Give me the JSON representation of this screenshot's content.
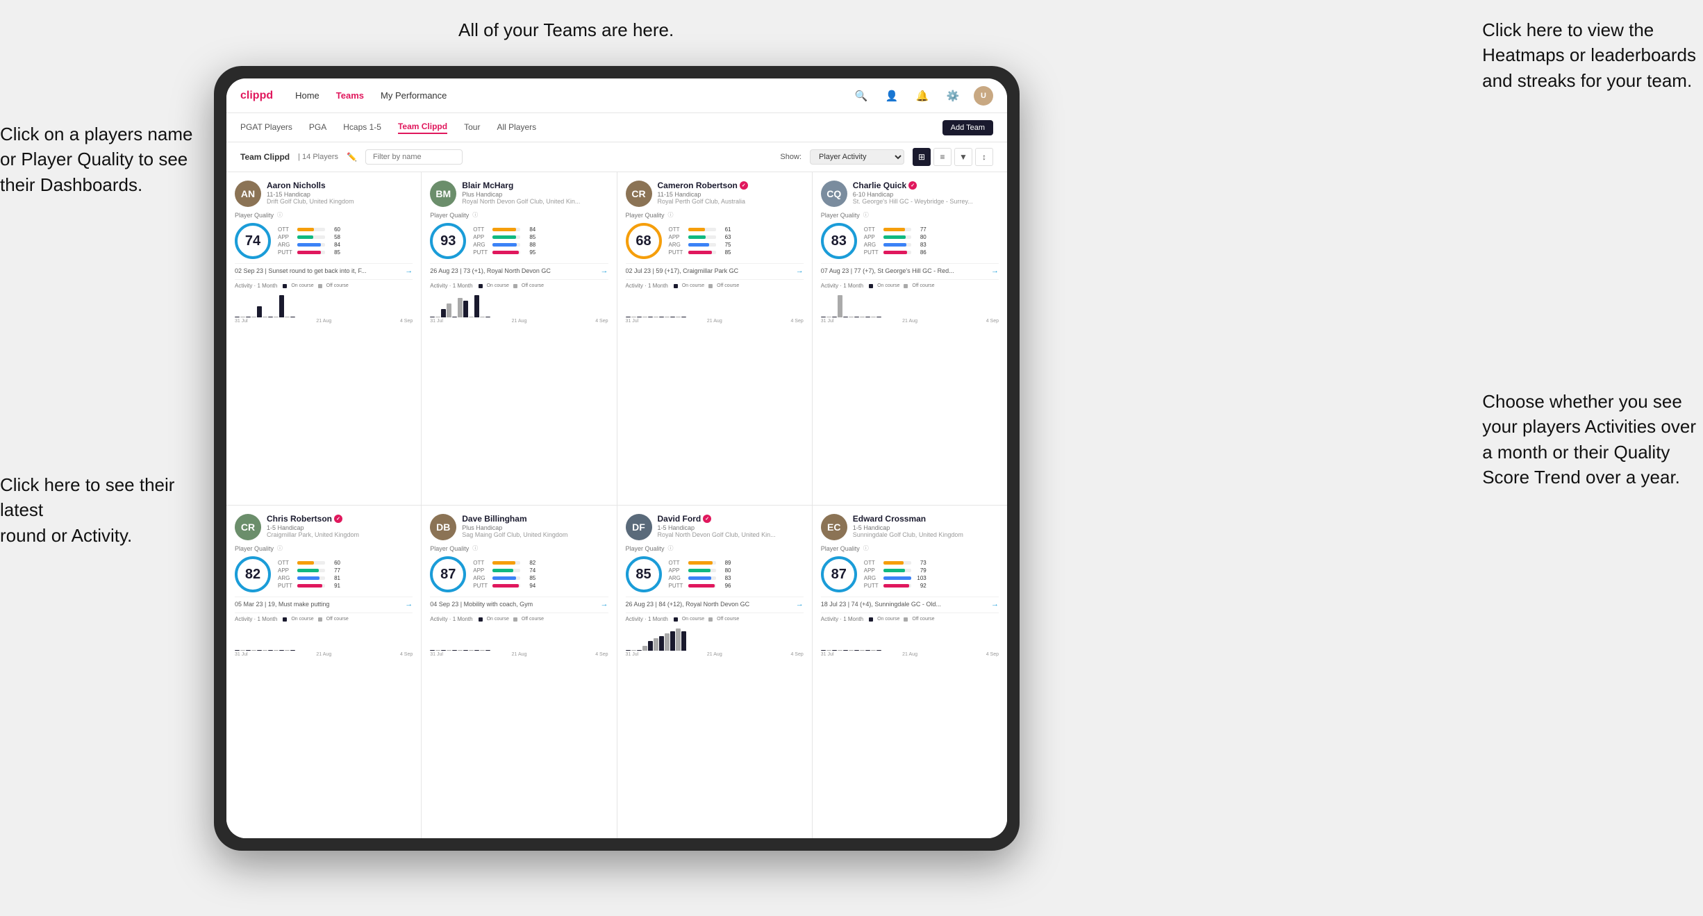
{
  "annotations": {
    "top_left": "Click on a players name\nor Player Quality to see\ntheir Dashboards.",
    "top_center": "All of your Teams are here.",
    "top_right": "Click here to view the\nHeatmaps or leaderboards\nand streaks for your team.",
    "bottom_left": "Click here to see their latest\nround or Activity.",
    "bottom_right": "Choose whether you see\nyour players Activities over\na month or their Quality\nScore Trend over a year."
  },
  "nav": {
    "logo": "clippd",
    "items": [
      "Home",
      "Teams",
      "My Performance"
    ],
    "active": "Teams"
  },
  "sub_nav": {
    "items": [
      "PGAT Players",
      "PGA",
      "Hcaps 1-5",
      "Team Clippd",
      "Tour",
      "All Players"
    ],
    "active": "Team Clippd",
    "add_button": "Add Team"
  },
  "toolbar": {
    "team_label": "Team Clippd",
    "separator": "|",
    "player_count": "14 Players",
    "filter_placeholder": "Filter by name",
    "show_label": "Show:",
    "show_option": "Player Activity",
    "view_label": "Grid view"
  },
  "players": [
    {
      "id": "aaron-nicholls",
      "name": "Aaron Nicholls",
      "handicap": "11-15 Handicap",
      "club": "Drift Golf Club, United Kingdom",
      "verified": false,
      "score": 74,
      "score_color": "#1a9cd8",
      "stats": {
        "OTT": {
          "value": 60,
          "pct": 60
        },
        "APP": {
          "value": 58,
          "pct": 58
        },
        "ARG": {
          "value": 84,
          "pct": 84
        },
        "PUTT": {
          "value": 85,
          "pct": 85
        }
      },
      "latest": "02 Sep 23 | Sunset round to get back into it, F...",
      "chart_bars": [
        0,
        0,
        0,
        0,
        2,
        0,
        0,
        0,
        4,
        0,
        0
      ],
      "chart_labels": [
        "31 Jul",
        "21 Aug",
        "4 Sep"
      ],
      "initials": "AN",
      "avatar_bg": "#8b7355"
    },
    {
      "id": "blair-mcharg",
      "name": "Blair McHarg",
      "handicap": "Plus Handicap",
      "club": "Royal North Devon Golf Club, United Kin...",
      "verified": false,
      "score": 93,
      "score_color": "#1a9cd8",
      "stats": {
        "OTT": {
          "value": 84,
          "pct": 84
        },
        "APP": {
          "value": 85,
          "pct": 85
        },
        "ARG": {
          "value": 88,
          "pct": 88
        },
        "PUTT": {
          "value": 95,
          "pct": 95
        }
      },
      "latest": "26 Aug 23 | 73 (+1), Royal North Devon GC",
      "chart_bars": [
        0,
        0,
        3,
        5,
        0,
        7,
        6,
        0,
        8,
        0,
        0
      ],
      "chart_labels": [
        "31 Jul",
        "21 Aug",
        "4 Sep"
      ],
      "initials": "BM",
      "avatar_bg": "#6b8e6b"
    },
    {
      "id": "cameron-robertson",
      "name": "Cameron Robertson",
      "handicap": "11-15 Handicap",
      "club": "Royal Perth Golf Club, Australia",
      "verified": true,
      "score": 68,
      "score_color": "#f59e0b",
      "stats": {
        "OTT": {
          "value": 61,
          "pct": 61
        },
        "APP": {
          "value": 63,
          "pct": 63
        },
        "ARG": {
          "value": 75,
          "pct": 75
        },
        "PUTT": {
          "value": 85,
          "pct": 85
        }
      },
      "latest": "02 Jul 23 | 59 (+17), Craigmillar Park GC",
      "chart_bars": [
        0,
        0,
        0,
        0,
        0,
        0,
        0,
        0,
        0,
        0,
        0
      ],
      "chart_labels": [
        "31 Jul",
        "21 Aug",
        "4 Sep"
      ],
      "initials": "CR",
      "avatar_bg": "#8b7355"
    },
    {
      "id": "charlie-quick",
      "name": "Charlie Quick",
      "handicap": "6-10 Handicap",
      "club": "St. George's Hill GC - Weybridge - Surrey...",
      "verified": true,
      "score": 83,
      "score_color": "#1a9cd8",
      "stats": {
        "OTT": {
          "value": 77,
          "pct": 77
        },
        "APP": {
          "value": 80,
          "pct": 80
        },
        "ARG": {
          "value": 83,
          "pct": 83
        },
        "PUTT": {
          "value": 86,
          "pct": 86
        }
      },
      "latest": "07 Aug 23 | 77 (+7), St George's Hill GC - Red...",
      "chart_bars": [
        0,
        0,
        0,
        4,
        0,
        0,
        0,
        0,
        0,
        0,
        0
      ],
      "chart_labels": [
        "31 Jul",
        "21 Aug",
        "4 Sep"
      ],
      "initials": "CQ",
      "avatar_bg": "#7a8c9e"
    },
    {
      "id": "chris-robertson",
      "name": "Chris Robertson",
      "handicap": "1-5 Handicap",
      "club": "Craigmillar Park, United Kingdom",
      "verified": true,
      "score": 82,
      "score_color": "#1a9cd8",
      "stats": {
        "OTT": {
          "value": 60,
          "pct": 60
        },
        "APP": {
          "value": 77,
          "pct": 77
        },
        "ARG": {
          "value": 81,
          "pct": 81
        },
        "PUTT": {
          "value": 91,
          "pct": 91
        }
      },
      "latest": "05 Mar 23 | 19, Must make putting",
      "chart_bars": [
        0,
        0,
        0,
        0,
        0,
        0,
        0,
        0,
        0,
        0,
        0
      ],
      "chart_labels": [
        "31 Jul",
        "21 Aug",
        "4 Sep"
      ],
      "initials": "CR",
      "avatar_bg": "#6b8e6b"
    },
    {
      "id": "dave-billingham",
      "name": "Dave Billingham",
      "handicap": "Plus Handicap",
      "club": "Sag Maing Golf Club, United Kingdom",
      "verified": false,
      "score": 87,
      "score_color": "#1a9cd8",
      "stats": {
        "OTT": {
          "value": 82,
          "pct": 82
        },
        "APP": {
          "value": 74,
          "pct": 74
        },
        "ARG": {
          "value": 85,
          "pct": 85
        },
        "PUTT": {
          "value": 94,
          "pct": 94
        }
      },
      "latest": "04 Sep 23 | Mobility with coach, Gym",
      "chart_bars": [
        0,
        0,
        0,
        0,
        0,
        0,
        0,
        0,
        0,
        0,
        0
      ],
      "chart_labels": [
        "31 Jul",
        "21 Aug",
        "4 Sep"
      ],
      "initials": "DB",
      "avatar_bg": "#8b7355"
    },
    {
      "id": "david-ford",
      "name": "David Ford",
      "handicap": "1-5 Handicap",
      "club": "Royal North Devon Golf Club, United Kin...",
      "verified": true,
      "score": 85,
      "score_color": "#1a9cd8",
      "stats": {
        "OTT": {
          "value": 89,
          "pct": 89
        },
        "APP": {
          "value": 80,
          "pct": 80
        },
        "ARG": {
          "value": 83,
          "pct": 83
        },
        "PUTT": {
          "value": 96,
          "pct": 96
        }
      },
      "latest": "26 Aug 23 | 84 (+12), Royal North Devon GC",
      "chart_bars": [
        0,
        0,
        0,
        2,
        4,
        5,
        6,
        7,
        8,
        9,
        8
      ],
      "chart_labels": [
        "31 Jul",
        "21 Aug",
        "4 Sep"
      ],
      "initials": "DF",
      "avatar_bg": "#5a6a7a"
    },
    {
      "id": "edward-crossman",
      "name": "Edward Crossman",
      "handicap": "1-5 Handicap",
      "club": "Sunningdale Golf Club, United Kingdom",
      "verified": false,
      "score": 87,
      "score_color": "#1a9cd8",
      "stats": {
        "OTT": {
          "value": 73,
          "pct": 73
        },
        "APP": {
          "value": 79,
          "pct": 79
        },
        "ARG": {
          "value": 103,
          "pct": 100
        },
        "PUTT": {
          "value": 92,
          "pct": 92
        }
      },
      "latest": "18 Jul 23 | 74 (+4), Sunningdale GC - Old...",
      "chart_bars": [
        0,
        0,
        0,
        0,
        0,
        0,
        0,
        0,
        0,
        0,
        0
      ],
      "chart_labels": [
        "31 Jul",
        "21 Aug",
        "4 Sep"
      ],
      "initials": "EC",
      "avatar_bg": "#8b7355"
    }
  ],
  "activity": {
    "label": "Activity",
    "period": "1 Month",
    "on_course": "On course",
    "off_course": "Off course",
    "on_color": "#1a1a2e",
    "off_color": "#aaa"
  }
}
